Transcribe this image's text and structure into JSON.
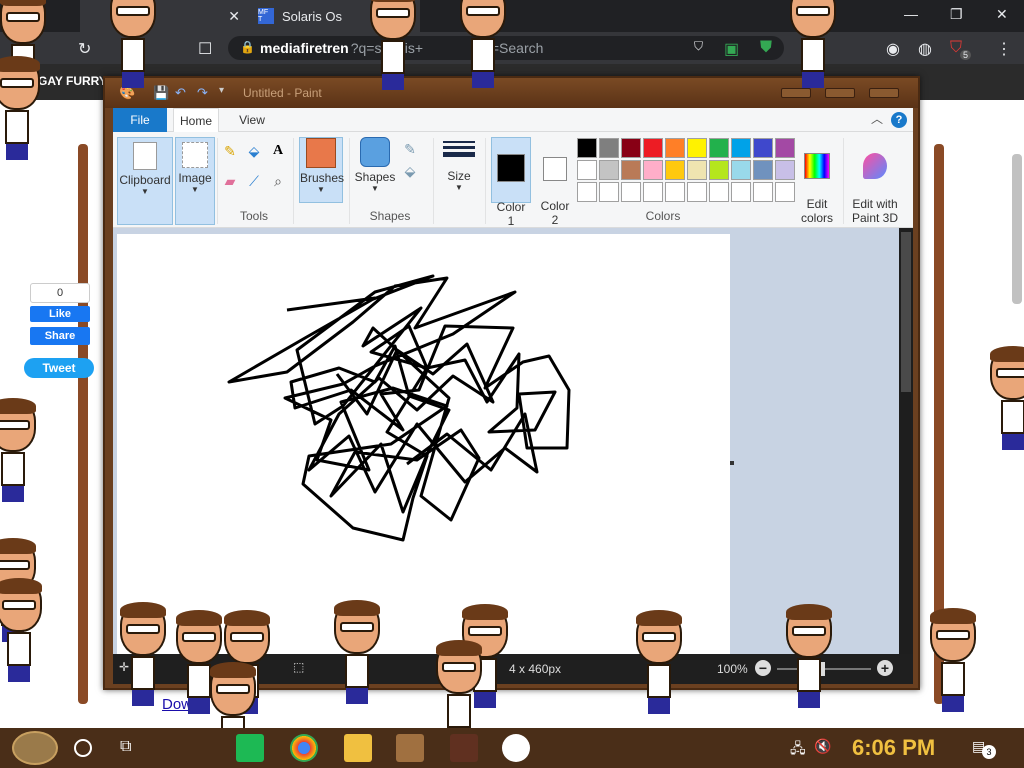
{
  "browser": {
    "tab1": {
      "title": "",
      "favicon": ""
    },
    "tab2": {
      "title": "Solaris Os",
      "favicon": "MF T"
    },
    "address": {
      "domain": "mediafiretren",
      "rest": "?q=solaris+",
      "suffix": "h=Search"
    },
    "extension_badge": "5"
  },
  "page": {
    "header_label": "GAY FURRY",
    "fb_count": "0",
    "fb_like": "Like",
    "fb_share": "Share",
    "tweet": "Tweet",
    "download_link": "Dow"
  },
  "paint": {
    "title": "Untitled - Paint",
    "tabs": {
      "file": "File",
      "home": "Home",
      "view": "View"
    },
    "groups": {
      "clipboard": "Clipboard",
      "image": "Image",
      "tools": "Tools",
      "brushes": "Brushes",
      "shapes_btn": "Shapes",
      "shapes_group": "Shapes",
      "size": "Size",
      "color1": "Color\n1",
      "color2": "Color\n2",
      "colors": "Colors",
      "edit_colors": "Edit\ncolors",
      "paint3d": "Edit with\nPaint 3D"
    },
    "palette_row1": [
      "#000000",
      "#7f7f7f",
      "#880015",
      "#ed1c24",
      "#ff7f27",
      "#fff200",
      "#22b14c",
      "#00a2e8",
      "#3f48cc",
      "#a349a4"
    ],
    "palette_row2": [
      "#ffffff",
      "#c3c3c3",
      "#b97a57",
      "#ffaec9",
      "#ffc90e",
      "#efe4b0",
      "#b5e61d",
      "#99d9ea",
      "#7092be",
      "#c8bfe7"
    ],
    "color1_value": "#000000",
    "color2_value": "#ffffff",
    "status_size": "4 x 460px",
    "zoom": "100%"
  },
  "taskbar": {
    "clock": "6:06 PM",
    "notifications": "3"
  }
}
